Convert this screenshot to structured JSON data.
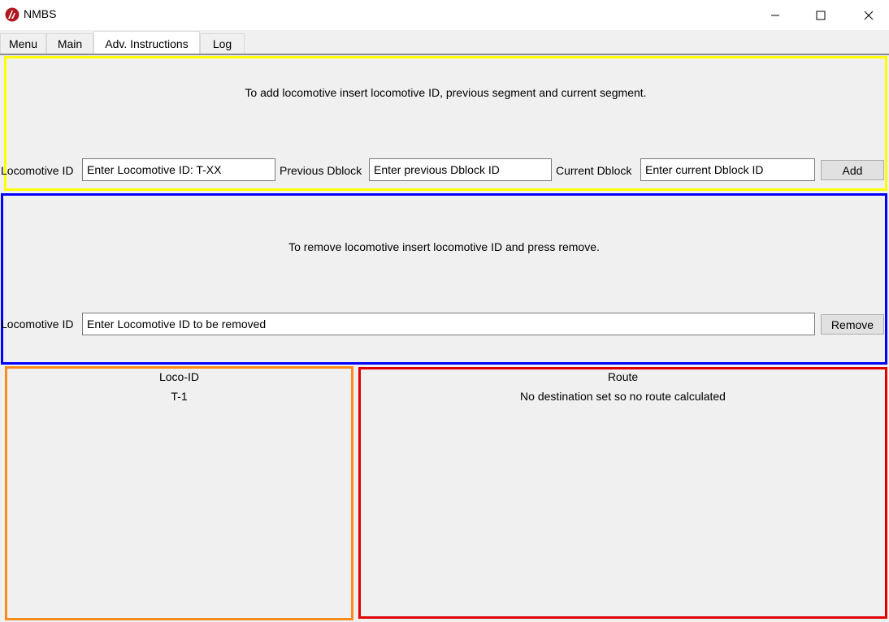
{
  "window": {
    "title": "NMBS",
    "minimize_icon": "minimize-icon",
    "maximize_icon": "maximize-icon",
    "close_icon": "close-icon"
  },
  "tabs": [
    {
      "label": "Menu",
      "active": false
    },
    {
      "label": "Main",
      "active": false
    },
    {
      "label": "Adv. Instructions",
      "active": true
    },
    {
      "label": "Log",
      "active": false
    }
  ],
  "add_panel": {
    "instruction": "To add locomotive insert locomotive ID, previous segment and current segment.",
    "loco_label": "Locomotive ID",
    "loco_value": "Enter Locomotive ID: T-XX",
    "prev_label": "Previous Dblock",
    "prev_value": "Enter previous Dblock ID",
    "curr_label": "Current Dblock",
    "curr_value": "Enter current Dblock ID",
    "add_button": "Add",
    "border_color": "#ffff00"
  },
  "remove_panel": {
    "instruction": "To remove locomotive insert locomotive ID and press remove.",
    "loco_label": "Locomotive ID",
    "loco_value": "Enter Locomotive ID to be removed",
    "remove_button": "Remove",
    "border_color": "#0000ff"
  },
  "loco_panel": {
    "header": "Loco-ID",
    "items": [
      "T-1"
    ],
    "border_color": "#ff8c1a"
  },
  "route_panel": {
    "header": "Route",
    "message": "No destination set so no route calculated",
    "border_color": "#e00000"
  }
}
